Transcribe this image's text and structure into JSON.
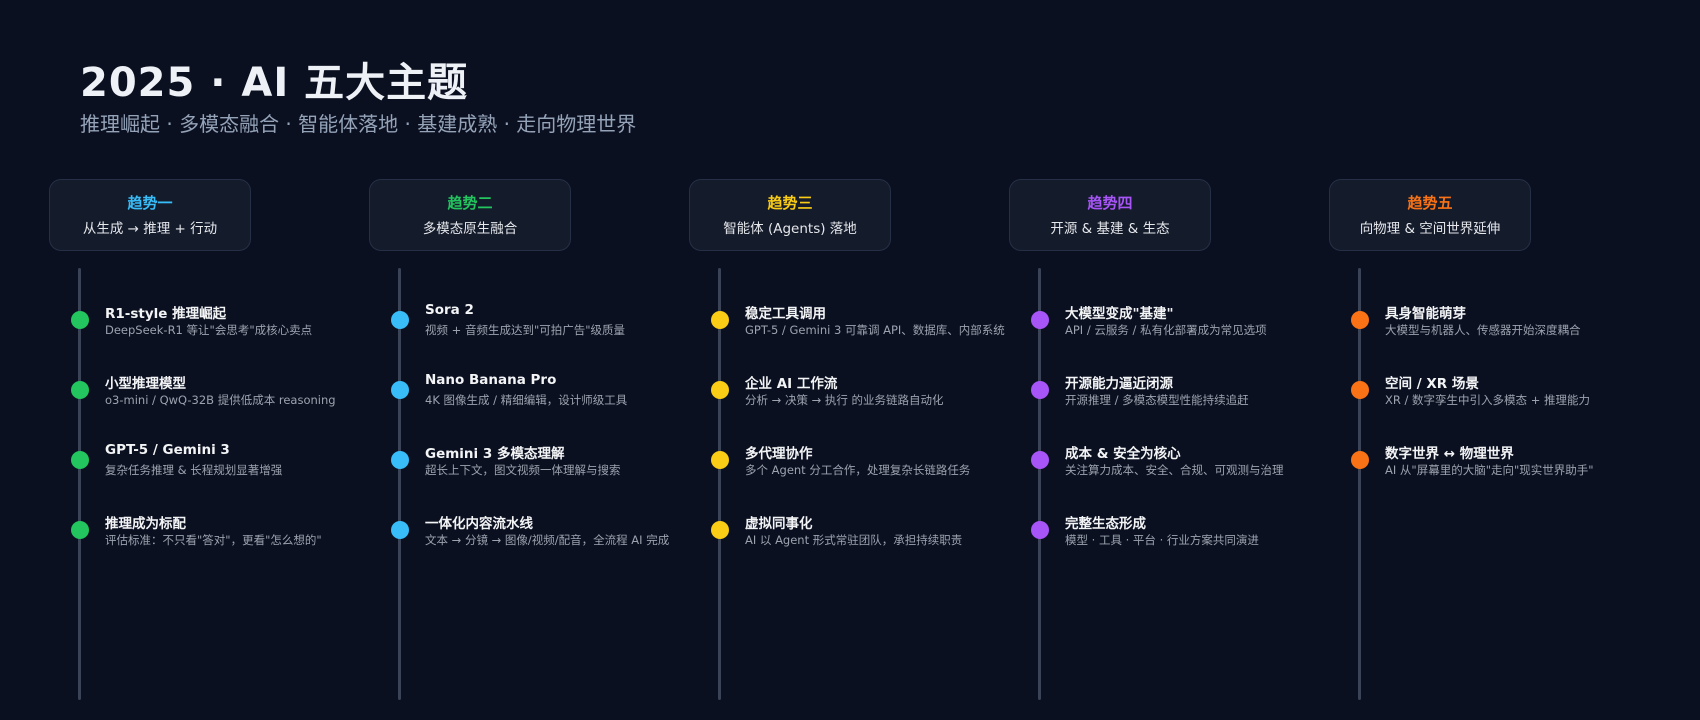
{
  "title": "2025 · AI 五大主题",
  "subtitle": "推理崛起 · 多模态融合 · 智能体落地 · 基建成熟 · 走向物理世界",
  "colors": {
    "background": "#0b1020",
    "card": "#141b2b",
    "axis": "#3a4456",
    "blue": "#38bdf8",
    "green": "#22c55e",
    "yellow": "#facc15",
    "purple": "#a855f7",
    "orange": "#f97316"
  },
  "columns": [
    {
      "label": "趋势一",
      "sub": "从生成 → 推理 + 行动",
      "label_color": "#38bdf8",
      "dot_color": "#22c55e",
      "items": [
        {
          "title": "R1-style 推理崛起",
          "desc": "DeepSeek-R1 等让\"会思考\"成核心卖点"
        },
        {
          "title": "小型推理模型",
          "desc": "o3-mini / QwQ-32B 提供低成本 reasoning"
        },
        {
          "title": "GPT-5 / Gemini 3",
          "desc": "复杂任务推理 & 长程规划显著增强"
        },
        {
          "title": "推理成为标配",
          "desc": "评估标准：不只看\"答对\"，更看\"怎么想的\""
        }
      ]
    },
    {
      "label": "趋势二",
      "sub": "多模态原生融合",
      "label_color": "#22c55e",
      "dot_color": "#38bdf8",
      "items": [
        {
          "title": "Sora 2",
          "desc": "视频 + 音频生成达到\"可拍广告\"级质量"
        },
        {
          "title": "Nano Banana Pro",
          "desc": "4K 图像生成 / 精细编辑，设计师级工具"
        },
        {
          "title": "Gemini 3 多模态理解",
          "desc": "超长上下文，图文视频一体理解与搜索"
        },
        {
          "title": "一体化内容流水线",
          "desc": "文本 → 分镜 → 图像/视频/配音，全流程 AI 完成"
        }
      ]
    },
    {
      "label": "趋势三",
      "sub": "智能体 (Agents) 落地",
      "label_color": "#facc15",
      "dot_color": "#facc15",
      "items": [
        {
          "title": "稳定工具调用",
          "desc": "GPT-5 / Gemini 3 可靠调 API、数据库、内部系统"
        },
        {
          "title": "企业 AI 工作流",
          "desc": "分析 → 决策 → 执行 的业务链路自动化"
        },
        {
          "title": "多代理协作",
          "desc": "多个 Agent 分工合作，处理复杂长链路任务"
        },
        {
          "title": "虚拟同事化",
          "desc": "AI 以 Agent 形式常驻团队，承担持续职责"
        }
      ]
    },
    {
      "label": "趋势四",
      "sub": "开源 & 基建 & 生态",
      "label_color": "#a855f7",
      "dot_color": "#a855f7",
      "items": [
        {
          "title": "大模型变成\"基建\"",
          "desc": "API / 云服务 / 私有化部署成为常见选项"
        },
        {
          "title": "开源能力逼近闭源",
          "desc": "开源推理 / 多模态模型性能持续追赶"
        },
        {
          "title": "成本 & 安全为核心",
          "desc": "关注算力成本、安全、合规、可观测与治理"
        },
        {
          "title": "完整生态形成",
          "desc": "模型 · 工具 · 平台 · 行业方案共同演进"
        }
      ]
    },
    {
      "label": "趋势五",
      "sub": "向物理 & 空间世界延伸",
      "label_color": "#f97316",
      "dot_color": "#f97316",
      "items": [
        {
          "title": "具身智能萌芽",
          "desc": "大模型与机器人、传感器开始深度耦合"
        },
        {
          "title": "空间 / XR 场景",
          "desc": "XR / 数字孪生中引入多模态 + 推理能力"
        },
        {
          "title": "数字世界 ↔ 物理世界",
          "desc": "AI 从\"屏幕里的大脑\"走向\"现实世界助手\""
        }
      ]
    }
  ]
}
